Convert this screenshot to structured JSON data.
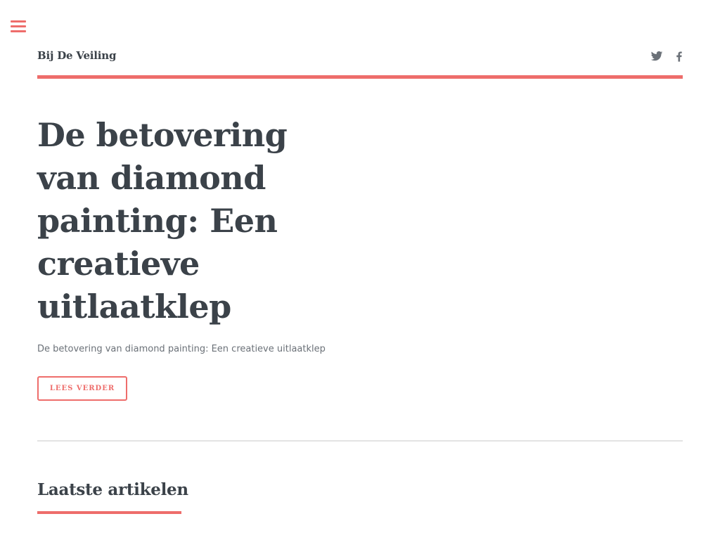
{
  "header": {
    "site_title": "Bij De Veiling",
    "menu_icon": "hamburger-menu-icon",
    "social": [
      {
        "name": "twitter",
        "icon": "twitter-icon"
      },
      {
        "name": "facebook",
        "icon": "facebook-icon"
      }
    ]
  },
  "hero": {
    "title": "De betovering van diamond painting: Een creatieve uitlaatklep",
    "excerpt": "De betovering van diamond painting: Een creatieve uitlaatklep",
    "read_more_label": "LEES VERDER"
  },
  "latest": {
    "heading": "Laatste artikelen"
  },
  "colors": {
    "accent": "#ee6d6b",
    "text": "#3b4249",
    "muted": "#6b7178",
    "icon": "#6b7178",
    "divider": "#e3e3e3"
  }
}
